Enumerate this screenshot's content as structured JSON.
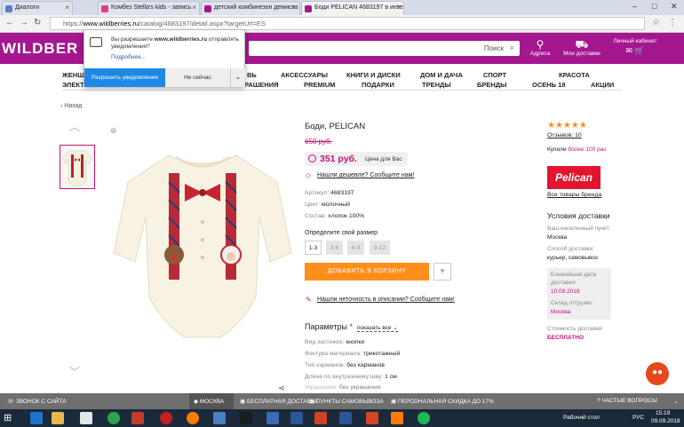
{
  "browser": {
    "tabs": [
      {
        "label": "Диалоги",
        "active": false,
        "color": "#5b7fbf"
      },
      {
        "label": "Комбез Stella's kids - запись",
        "active": false,
        "color": "#e23d7a"
      },
      {
        "label": "детский комбинезон демисез",
        "active": false,
        "color": "#a4178f"
      },
      {
        "label": "Боди PELICAN 4683197 в инте",
        "active": true,
        "color": "#a4178f"
      }
    ],
    "url_host": "www.wildberries.ru",
    "url_prefix": "https://",
    "url_path": "/catalog/4683197/detail.aspx?targetUrl=ES"
  },
  "site": {
    "logo": "WILDBER",
    "search_label": "Поиск",
    "header_items": [
      {
        "label": "Адреса",
        "icon": "location-pin-icon"
      },
      {
        "label": "Мои доставки",
        "icon": "truck-icon"
      },
      {
        "label": "Личный кабинет",
        "icon": "mail-icon"
      }
    ],
    "cart_count": "0",
    "menu_row1": [
      "ЖЕНЩ",
      "ВЬ",
      "АКСЕССУАРЫ",
      "КНИГИ И ДИСКИ",
      "ДОМ И ДАЧА",
      "СПОРТ",
      "КРАСОТА"
    ],
    "menu_row2": [
      "ЭЛЕКТ",
      "РАШЕНИЯ",
      "PREMIUM",
      "ПОДАРКИ",
      "ТРЕНДЫ",
      "БРЕНДЫ",
      "ОСЕНЬ 18",
      "АКЦИИ"
    ]
  },
  "notification": {
    "text_pre": "Вы разрешаете ",
    "text_host": "www.wildberries.ru",
    "text_post": " отправлять уведомления?",
    "more_link": "Подробнее...",
    "allow": "Разрешить уведомления",
    "deny": "Не сейчас"
  },
  "product": {
    "back": "Назад",
    "title": "Боди, PELICAN",
    "old_price": "650 руб.",
    "price": "351 руб.",
    "price_label": "Цена для Вас",
    "cheaper_link": "Нашли дешевле? Сообщите нам!",
    "specs": [
      {
        "label": "Артикул: ",
        "value": "4683197"
      },
      {
        "label": "Цвет: ",
        "value": "молочный"
      },
      {
        "label": "Состав: ",
        "value": "хлопок 100%"
      }
    ],
    "size_label": "Определите свой размер",
    "sizes": [
      {
        "label": "1-3",
        "available": true
      },
      {
        "label": "3-6",
        "available": false
      },
      {
        "label": "6-9",
        "available": false
      },
      {
        "label": "9-12",
        "available": false
      }
    ],
    "add_to_cart": "ДОБАВИТЬ В КОРЗИНУ",
    "mistake_link": "Нашли неточность в описании? Сообщите нам!",
    "params_title": "Параметры",
    "params_link": "показать все",
    "params": [
      {
        "label": "Вид застежки: ",
        "value": "кнопки"
      },
      {
        "label": "Фактура материала: ",
        "value": "трикотажный"
      },
      {
        "label": "Тип карманов: ",
        "value": "без карманов"
      },
      {
        "label": "Длина по внутреннему шву: ",
        "value": "1 см"
      },
      {
        "label": "Украшение: ",
        "value": "без украшения"
      }
    ]
  },
  "sidebar": {
    "reviews": "Отзывов: 10",
    "bought_pre": "Купили ",
    "bought_val": "более 100 раз",
    "brand": "Pelican",
    "all_brand": "Все товары бренда",
    "delivery_title": "Условия доставки",
    "city_label": "Ваш населенный пункт:",
    "city": "Москва",
    "method_label": "Способ доставки:",
    "method": "курьер, самовывоз",
    "nearest_label1": "Ближайшая дата",
    "nearest_label2": "доставки:",
    "nearest_date": "10.09.2018",
    "warehouse_label": "Склад отгрузки:",
    "warehouse": "Москва",
    "cost_label": "Стоимость доставки:",
    "cost": "БЕСПЛАТНО"
  },
  "infobar": {
    "items": [
      "ЗВОНОК С САЙТА",
      "МОСКВА",
      "БЕСПЛАТНАЯ ДОСТАВКА",
      "ПУНКТЫ САМОВЫВОЗА",
      "ПЕРСОНАЛЬНАЯ СКИДКА ДО 17%",
      "ЧАСТЫЕ ВОПРОСЫ"
    ]
  },
  "taskbar": {
    "desktop": "Рабочий стол",
    "lang": "РУС",
    "time": "15:19",
    "date": "09.09.2018"
  }
}
